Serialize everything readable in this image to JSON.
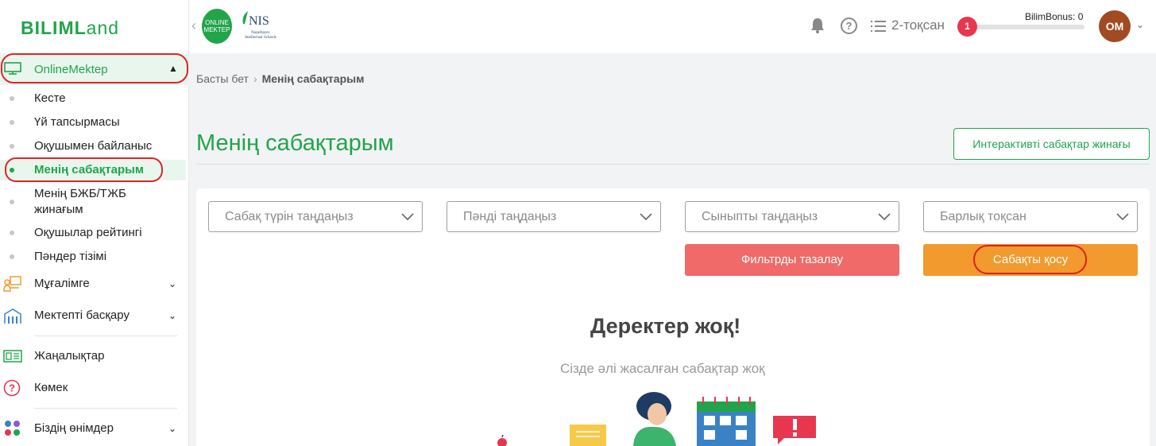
{
  "brand": {
    "logo_text_bold": "BILIML",
    "logo_text_thin": "and",
    "colors": {
      "primary_green": "#21a44a",
      "danger": "#ef6a68",
      "warning": "#f29a2e",
      "highlight_ring": "#e02424"
    }
  },
  "sidebar": {
    "section_label": "OnlineMektep",
    "sub_items": [
      {
        "label": "Кесте"
      },
      {
        "label": "Үй тапсырмасы"
      },
      {
        "label": "Оқушымен байланыс"
      },
      {
        "label": "Менің сабақтарым",
        "active": true
      },
      {
        "label": "Менің БЖБ/ТЖБ жинағым"
      },
      {
        "label": "Оқушылар рейтингі"
      },
      {
        "label": "Пәндер тізімі"
      }
    ],
    "menu": [
      {
        "label": "Мұғалімге",
        "icon": "teacher-icon",
        "expandable": true
      },
      {
        "label": "Мектепті басқару",
        "icon": "school-building-icon",
        "expandable": true
      },
      {
        "label": "Жаңалықтар",
        "icon": "newspaper-icon",
        "expandable": false
      },
      {
        "label": "Көмек",
        "icon": "help-circle-icon",
        "expandable": false
      },
      {
        "label": "Біздің өнімдер",
        "icon": "products-icon",
        "expandable": true
      }
    ]
  },
  "header": {
    "online_mektep_logo": "ONLINE MEKTEP",
    "nis_logo": {
      "abbr": "NIS",
      "full": "Nazarbayev Intellectual Schools"
    },
    "quarter_label": "2-тоқсан",
    "notification_count": "1",
    "bonus_label": "BilimBonus: 0",
    "bonus_progress": 0,
    "avatar_initials": "OM"
  },
  "breadcrumb": {
    "home": "Басты бет",
    "current": "Менің сабақтарым"
  },
  "page": {
    "title": "Менің сабақтарым",
    "interactive_button": "Интерактивті сабақтар жинағы"
  },
  "filters": {
    "selects": [
      {
        "placeholder": "Сабақ түрін таңдаңыз"
      },
      {
        "placeholder": "Пәнді таңдаңыз"
      },
      {
        "placeholder": "Сыныпты таңдаңыз"
      },
      {
        "placeholder": "Барлық тоқсан"
      }
    ],
    "clear_button": "Фильтрды тазалау",
    "add_lesson_button": "Сабақты қосу"
  },
  "empty_state": {
    "title": "Деректер жоқ!",
    "subtitle": "Сізде әлі жасалған сабақтар жоқ"
  }
}
